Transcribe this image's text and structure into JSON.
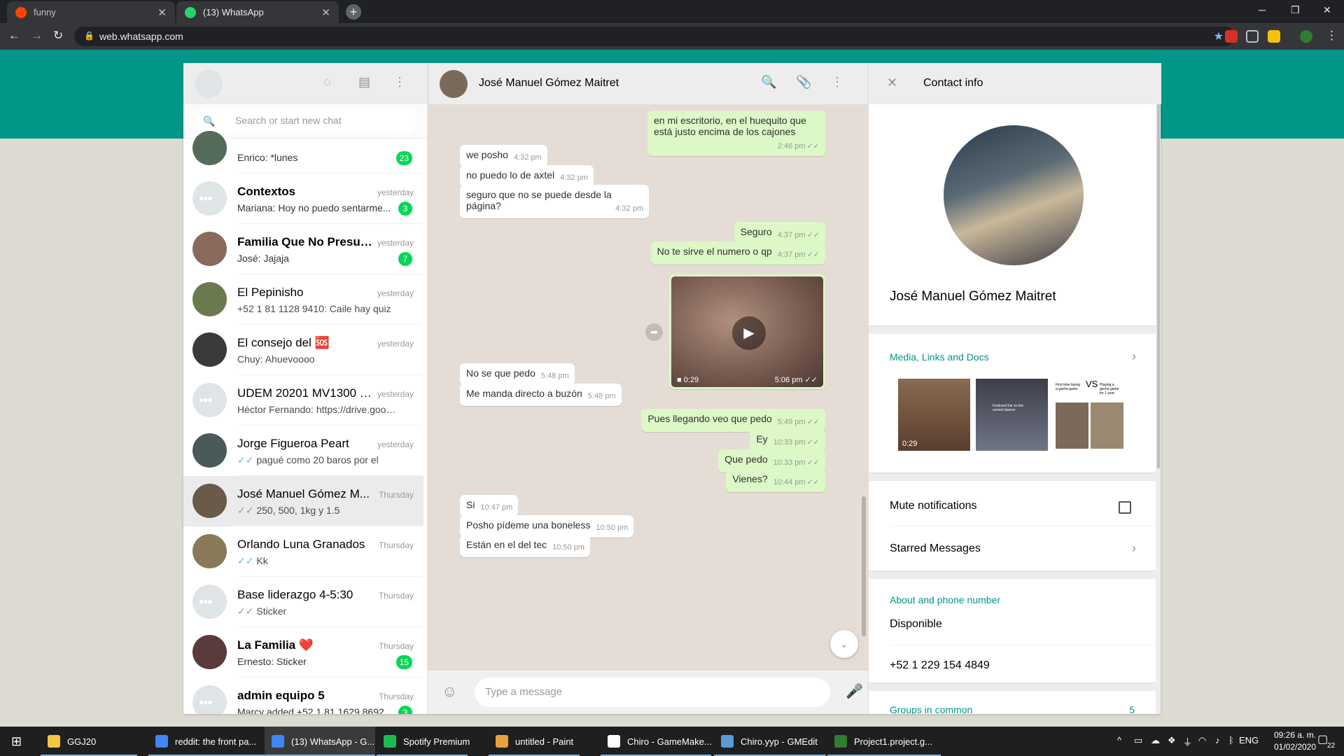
{
  "browser": {
    "tabs": [
      {
        "title": "funny",
        "active": false
      },
      {
        "title": "(13) WhatsApp",
        "active": true
      }
    ],
    "url": "web.whatsapp.com"
  },
  "left": {
    "search_placeholder": "Search or start new chat",
    "chats": [
      {
        "name": "",
        "time": "",
        "last": "Enrico: *lunes",
        "badge": "23",
        "unread": true,
        "avatar": "photo",
        "ticks": ""
      },
      {
        "name": "Contextos",
        "time": "yesterday",
        "last": "Mariana: Hoy no puedo sentarme...",
        "badge": "3",
        "unread": true,
        "avatar": "group",
        "ticks": ""
      },
      {
        "name": "Familia Que No Presup...",
        "time": "yesterday",
        "last": "José: Jajaja",
        "badge": "7",
        "unread": true,
        "avatar": "photo",
        "ticks": ""
      },
      {
        "name": "El Pepinisho",
        "time": "yesterday",
        "last": "+52 1 81 1128 9410: Caile hay quiz",
        "badge": "",
        "unread": false,
        "avatar": "photo",
        "ticks": ""
      },
      {
        "name": "El consejo del 🆘",
        "time": "yesterday",
        "last": "Chuy: Ahuevoooo",
        "badge": "",
        "unread": false,
        "avatar": "photo",
        "ticks": ""
      },
      {
        "name": "UDEM 20201 MV1300 C...",
        "time": "yesterday",
        "last": "Héctor Fernando: https://drive.google...",
        "badge": "",
        "unread": false,
        "avatar": "group",
        "ticks": ""
      },
      {
        "name": "Jorge Figueroa Peart",
        "time": "yesterday",
        "last": "pagué como 20 baros por el",
        "badge": "",
        "unread": false,
        "avatar": "photo",
        "ticks": "blue"
      },
      {
        "name": "José Manuel Gómez M...",
        "time": "Thursday",
        "last": "250, 500, 1kg y 1.5",
        "badge": "",
        "unread": false,
        "avatar": "photo",
        "ticks": "grey",
        "selected": true
      },
      {
        "name": "Orlando Luna Granados",
        "time": "Thursday",
        "last": "Kk",
        "badge": "",
        "unread": false,
        "avatar": "photo",
        "ticks": "blue"
      },
      {
        "name": "Base liderazgo 4-5:30",
        "time": "Thursday",
        "last": "Sticker",
        "badge": "",
        "unread": false,
        "avatar": "group",
        "ticks": "grey"
      },
      {
        "name": "La Familia ❤️",
        "time": "Thursday",
        "last": "Ernesto: Sticker",
        "badge": "15",
        "unread": true,
        "avatar": "photo",
        "ticks": ""
      },
      {
        "name": "admin equipo 5",
        "time": "Thursday",
        "last": "Marcy added +52 1 81 1629 8692",
        "badge": "3",
        "unread": true,
        "avatar": "group",
        "ticks": ""
      }
    ]
  },
  "conversation": {
    "contact_name": "José Manuel Gómez Maitret",
    "composer_placeholder": "Type a message",
    "messages": [
      {
        "dir": "out",
        "text": "en mi escritorio, en el huequito que está justo encima de los cajones",
        "time": "2:46 pm"
      },
      {
        "dir": "in",
        "text": "we posho",
        "time": "4:32 pm"
      },
      {
        "dir": "in",
        "text": "no puedo lo de axtel",
        "time": "4:32 pm"
      },
      {
        "dir": "in",
        "text": "seguro que no se puede desde la página?",
        "time": "4:32 pm"
      },
      {
        "dir": "out",
        "text": "Seguro",
        "time": "4:37 pm"
      },
      {
        "dir": "out",
        "text": "No te sirve el numero o qp",
        "time": "4:37 pm"
      },
      {
        "dir": "in",
        "text": "No se que pedo",
        "time": "5:48 pm"
      },
      {
        "dir": "in",
        "text": "Me manda directo a buzón",
        "time": "5:48 pm"
      },
      {
        "dir": "out",
        "text": "Pues llegando veo que pedo",
        "time": "5:49 pm"
      },
      {
        "dir": "out",
        "text": "Ey",
        "time": "10:33 pm"
      },
      {
        "dir": "out",
        "text": "Que pedo",
        "time": "10:33 pm"
      },
      {
        "dir": "out",
        "text": "Vienes?",
        "time": "10:44 pm"
      },
      {
        "dir": "in",
        "text": "Si",
        "time": "10:47 pm"
      },
      {
        "dir": "in",
        "text": "Posho pídeme una boneless",
        "time": "10:50 pm"
      },
      {
        "dir": "in",
        "text": "Están en el del tec",
        "time": "10:50 pm"
      }
    ],
    "video": {
      "duration": "0:29",
      "time": "5:06 pm"
    }
  },
  "contact_info": {
    "title": "Contact info",
    "name": "José Manuel Gómez Maitret",
    "media_title": "Media, Links and Docs",
    "media_video_duration": "0:29",
    "mute_label": "Mute notifications",
    "starred_label": "Starred Messages",
    "about_title": "About and phone number",
    "about": "Disponible",
    "phone": "+52 1 229 154 4849",
    "groups_title": "Groups in common",
    "groups_count": "5",
    "media_texts": {
      "featured": "Featured 5★ on the current banner",
      "vs": "VS",
      "first": "First time laying a gacha game",
      "playing": "Playing a gacha game for 1 year"
    }
  },
  "taskbar": {
    "items": [
      {
        "label": "GGJ20",
        "color": "#f4c542"
      },
      {
        "label": "reddit: the front pa...",
        "color": "#4285f4"
      },
      {
        "label": "(13) WhatsApp - G...",
        "color": "#4285f4",
        "active": true
      },
      {
        "label": "Spotify Premium",
        "color": "#1db954"
      },
      {
        "label": "untitled - Paint",
        "color": "#e8a23c"
      },
      {
        "label": "Chiro - GameMake...",
        "color": "#ffffff"
      },
      {
        "label": "Chiro.yyp - GMEdit",
        "color": "#5b9bd5"
      },
      {
        "label": "Project1.project.g...",
        "color": "#2e7d32"
      }
    ],
    "language": "ENG",
    "time": "09:26 a. m.",
    "date": "01/02/2020",
    "notifications": "22"
  },
  "colors": {
    "accent": "#009688",
    "out_bubble": "#dcf8c6",
    "badge": "#06d755"
  }
}
